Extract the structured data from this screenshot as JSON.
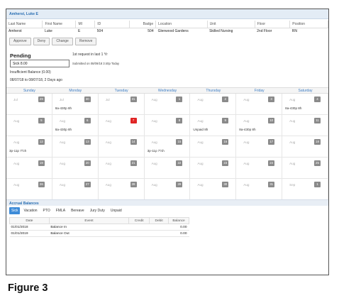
{
  "panel": {
    "title": "Amherst, Luke E"
  },
  "info": {
    "headers": [
      "Last Name",
      "First Name",
      "MI",
      "ID",
      "Badge",
      "Location",
      "Unit",
      "Floor",
      "Position"
    ],
    "values": [
      "Amherst",
      "Luke",
      "E",
      "504",
      "504",
      "Glenwood Gardens",
      "Skilled Nursing",
      "2nd Floor",
      "RN"
    ]
  },
  "actions": {
    "approve": "Approve",
    "deny": "Deny",
    "change": "Change",
    "remove": "Remove"
  },
  "pending": {
    "title": "Pending",
    "value": "Sick 8.00",
    "request_count": "1st request in last 1 Yr",
    "submitted": "Submitted on 08/09/18 3:40p Today",
    "balance_note": "Insufficient Balance (0.00)",
    "date_range": "08/07/18 to 08/07/18, 2 Days ago"
  },
  "calendar": {
    "weekdays": [
      "Sunday",
      "Monday",
      "Tuesday",
      "Wednesday",
      "Thursday",
      "Friday",
      "Saturday"
    ],
    "days": [
      {
        "mon": "Jul",
        "num": "29",
        "shift": ""
      },
      {
        "mon": "Jul",
        "num": "30",
        "shift": "8a-430p  8h"
      },
      {
        "mon": "Jul",
        "num": "31",
        "shift": ""
      },
      {
        "mon": "Aug",
        "num": "1",
        "shift": ""
      },
      {
        "mon": "Aug",
        "num": "2",
        "shift": ""
      },
      {
        "mon": "Aug",
        "num": "3",
        "shift": ""
      },
      {
        "mon": "Aug",
        "num": "4",
        "shift": "8a-430p  8h"
      },
      {
        "mon": "Aug",
        "num": "5",
        "shift": ""
      },
      {
        "mon": "Aug",
        "num": "6",
        "shift": "8a-430p  8h"
      },
      {
        "mon": "Aug",
        "num": "7",
        "shift": "",
        "today": true
      },
      {
        "mon": "Aug",
        "num": "8",
        "shift": ""
      },
      {
        "mon": "Aug",
        "num": "9",
        "shift": "Unpaid  8h"
      },
      {
        "mon": "Aug",
        "num": "10",
        "shift": "8a-430p  8h"
      },
      {
        "mon": "Aug",
        "num": "11",
        "shift": ""
      },
      {
        "mon": "Aug",
        "num": "12",
        "shift": "3p-11p  7½h"
      },
      {
        "mon": "Aug",
        "num": "13",
        "shift": ""
      },
      {
        "mon": "Aug",
        "num": "14",
        "shift": ""
      },
      {
        "mon": "Aug",
        "num": "15",
        "shift": "3p-11p  7½h"
      },
      {
        "mon": "Aug",
        "num": "16",
        "shift": ""
      },
      {
        "mon": "Aug",
        "num": "17",
        "shift": ""
      },
      {
        "mon": "Aug",
        "num": "18",
        "shift": ""
      },
      {
        "mon": "Aug",
        "num": "19",
        "shift": ""
      },
      {
        "mon": "Aug",
        "num": "20",
        "shift": ""
      },
      {
        "mon": "Aug",
        "num": "21",
        "shift": ""
      },
      {
        "mon": "Aug",
        "num": "22",
        "shift": ""
      },
      {
        "mon": "Aug",
        "num": "23",
        "shift": ""
      },
      {
        "mon": "Aug",
        "num": "24",
        "shift": ""
      },
      {
        "mon": "Aug",
        "num": "25",
        "shift": ""
      },
      {
        "mon": "Aug",
        "num": "26",
        "shift": ""
      },
      {
        "mon": "Aug",
        "num": "27",
        "shift": ""
      },
      {
        "mon": "Aug",
        "num": "28",
        "shift": ""
      },
      {
        "mon": "Aug",
        "num": "29",
        "shift": ""
      },
      {
        "mon": "Aug",
        "num": "30",
        "shift": ""
      },
      {
        "mon": "Aug",
        "num": "31",
        "shift": ""
      },
      {
        "mon": "Sep",
        "num": "1",
        "shift": ""
      }
    ]
  },
  "accruals": {
    "title": "Accrual Balances",
    "tabs": [
      "Sick",
      "Vacation",
      "PTO",
      "FMLA",
      "Bereave",
      "Jury Duty",
      "Unpaid"
    ],
    "active_tab": "Sick",
    "columns": [
      "Date",
      "Event",
      "Credit",
      "Debit",
      "Balance"
    ],
    "rows": [
      [
        "01/01/2018",
        "Balance In",
        "",
        "",
        "0.00"
      ],
      [
        "01/01/2019",
        "Balance Out",
        "",
        "",
        "0.00"
      ]
    ]
  },
  "caption": "Figure 3",
  "colors": {
    "accent": "#3d8bd8",
    "today": "#e02424",
    "day_badge": "#8a8a8a"
  }
}
